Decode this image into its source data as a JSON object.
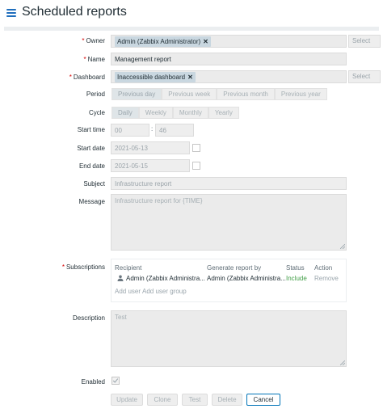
{
  "header": {
    "title": "Scheduled reports"
  },
  "form": {
    "owner": {
      "label": "Owner",
      "value": "Admin (Zabbix Administrator)",
      "button": "Select"
    },
    "name": {
      "label": "Name",
      "value": "Management report"
    },
    "dashboard": {
      "label": "Dashboard",
      "value": "Inaccessible dashboard",
      "button": "Select"
    },
    "period": {
      "label": "Period",
      "options": [
        "Previous day",
        "Previous week",
        "Previous month",
        "Previous year"
      ],
      "selected": "Previous day"
    },
    "cycle": {
      "label": "Cycle",
      "options": [
        "Daily",
        "Weekly",
        "Monthly",
        "Yearly"
      ],
      "selected": "Daily"
    },
    "start_time": {
      "label": "Start time",
      "hours": "00",
      "separator": ":",
      "minutes": "46"
    },
    "start_date": {
      "label": "Start date",
      "value": "2021-05-13"
    },
    "end_date": {
      "label": "End date",
      "value": "2021-05-15"
    },
    "subject": {
      "label": "Subject",
      "placeholder": "Infrastructure report"
    },
    "message": {
      "label": "Message",
      "value": "Infrastructure report for {TIME}"
    },
    "subscriptions": {
      "label": "Subscriptions",
      "headers": {
        "recipient": "Recipient",
        "generate_by": "Generate report by",
        "status": "Status",
        "action": "Action"
      },
      "rows": [
        {
          "recipient": "Admin (Zabbix Administra...",
          "generate_by": "Admin (Zabbix Administra...",
          "status": "Include",
          "action": "Remove"
        }
      ],
      "add_user": "Add user",
      "add_user_group": "Add user group"
    },
    "description": {
      "label": "Description",
      "value": "Test"
    },
    "enabled": {
      "label": "Enabled",
      "checked": true
    }
  },
  "buttons": {
    "update": "Update",
    "clone": "Clone",
    "test": "Test",
    "delete": "Delete",
    "cancel": "Cancel"
  },
  "colors": {
    "accent": "#1f6ebd",
    "status_include": "#429e47",
    "required": "#d40000"
  }
}
